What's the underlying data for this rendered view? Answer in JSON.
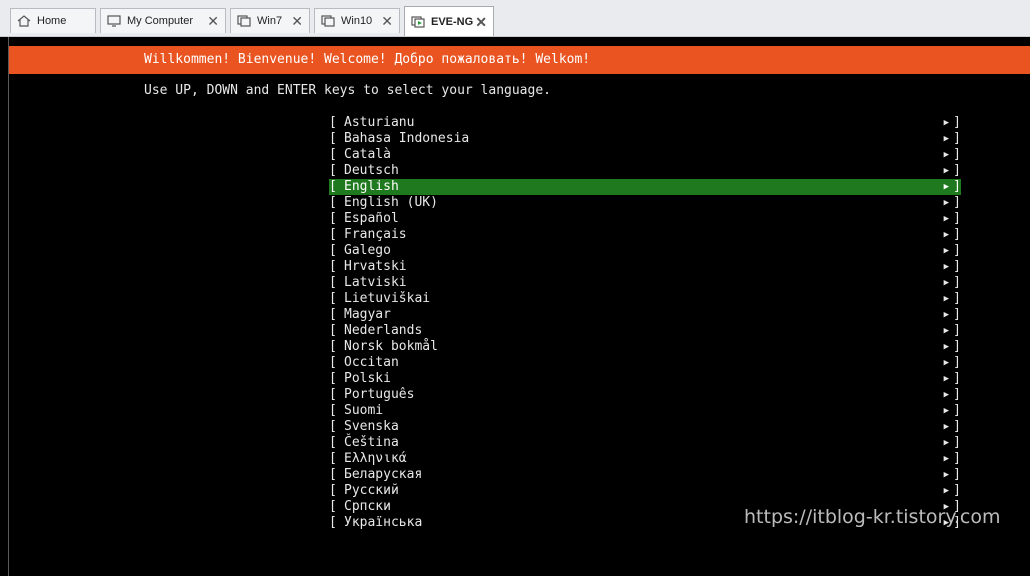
{
  "tabs": [
    {
      "label": "Home",
      "icon": "home-icon",
      "closable": false,
      "active": false
    },
    {
      "label": "My Computer",
      "icon": "computer-icon",
      "closable": true,
      "active": false
    },
    {
      "label": "Win7",
      "icon": "vm-icon",
      "closable": true,
      "active": false
    },
    {
      "label": "Win10",
      "icon": "vm-icon",
      "closable": true,
      "active": false
    },
    {
      "label": "EVE-NG",
      "icon": "vm-running-icon",
      "closable": true,
      "active": true
    }
  ],
  "close_glyph": "✕",
  "installer": {
    "welcome": "Willkommen! Bienvenue! Welcome! Добро пожаловать! Welkom!",
    "instructions": "Use UP, DOWN and ENTER keys to select your language.",
    "bracket_open": "[",
    "bracket_close": "]",
    "arrow": "▶",
    "selected_index": 4,
    "languages": [
      "Asturianu",
      "Bahasa Indonesia",
      "Català",
      "Deutsch",
      "English",
      "English (UK)",
      "Español",
      "Français",
      "Galego",
      "Hrvatski",
      "Latviski",
      "Lietuviškai",
      "Magyar",
      "Nederlands",
      "Norsk bokmål",
      "Occitan",
      "Polski",
      "Português",
      "Suomi",
      "Svenska",
      "Čeština",
      "Ελληνικά",
      "Беларуская",
      "Русский",
      "Српски",
      "Українська"
    ]
  },
  "watermark": "https://itblog-kr.tistory.com",
  "colors": {
    "accent": "#e95420",
    "selection": "#1f7a1f",
    "console_bg": "#000000",
    "tabbar_bg": "#e9ebee"
  }
}
